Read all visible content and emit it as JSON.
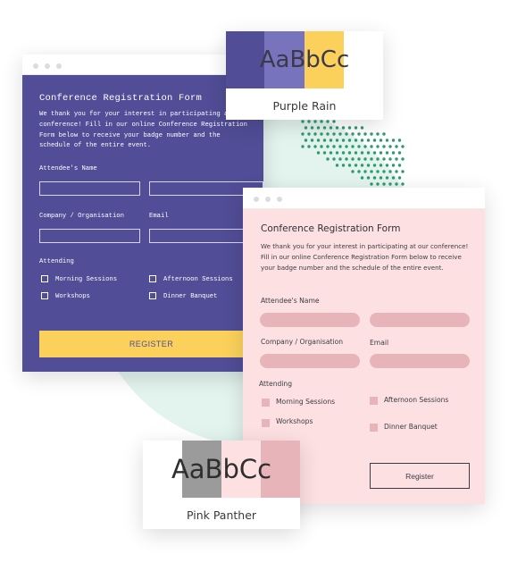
{
  "purple_card": {
    "sample": "AaBbCc",
    "name": "Purple Rain",
    "colors": [
      "#514d96",
      "#7773bd",
      "#fbd15b",
      "#ffffff"
    ]
  },
  "pink_card": {
    "sample": "AaBbCc",
    "name": "Pink Panther",
    "colors": [
      "#ffffff",
      "#9b9b9b",
      "#fde0e1",
      "#e7b5b9"
    ]
  },
  "purple_form": {
    "title": "Conference Registration Form",
    "intro": "We thank you for your interest in participating at our conference! Fill in our online Conference Registration Form below to receive your badge number and the schedule of the entire event.",
    "attendee_label": "Attendee's Name",
    "company_label": "Company / Organisation",
    "email_label": "Email",
    "attending_label": "Attending",
    "options": [
      "Morning Sessions",
      "Afternoon Sessions",
      "Workshops",
      "Dinner Banquet"
    ],
    "button": "REGISTER",
    "accent": "#514d96",
    "button_color": "#fbd15b"
  },
  "pink_form": {
    "title": "Conference Registration Form",
    "intro": "We thank you for your interest in participating at our conference! Fill in our online Conference Registration Form below to receive your badge number and the schedule of the entire event.",
    "attendee_label": "Attendee's Name",
    "company_label": "Company / Organisation",
    "email_label": "Email",
    "attending_label": "Attending",
    "options": [
      "Morning Sessions",
      "Afternoon Sessions",
      "Workshops",
      "Dinner Banquet"
    ],
    "button": "Register",
    "accent": "#fde0e1",
    "field_color": "#e7b5b9"
  }
}
